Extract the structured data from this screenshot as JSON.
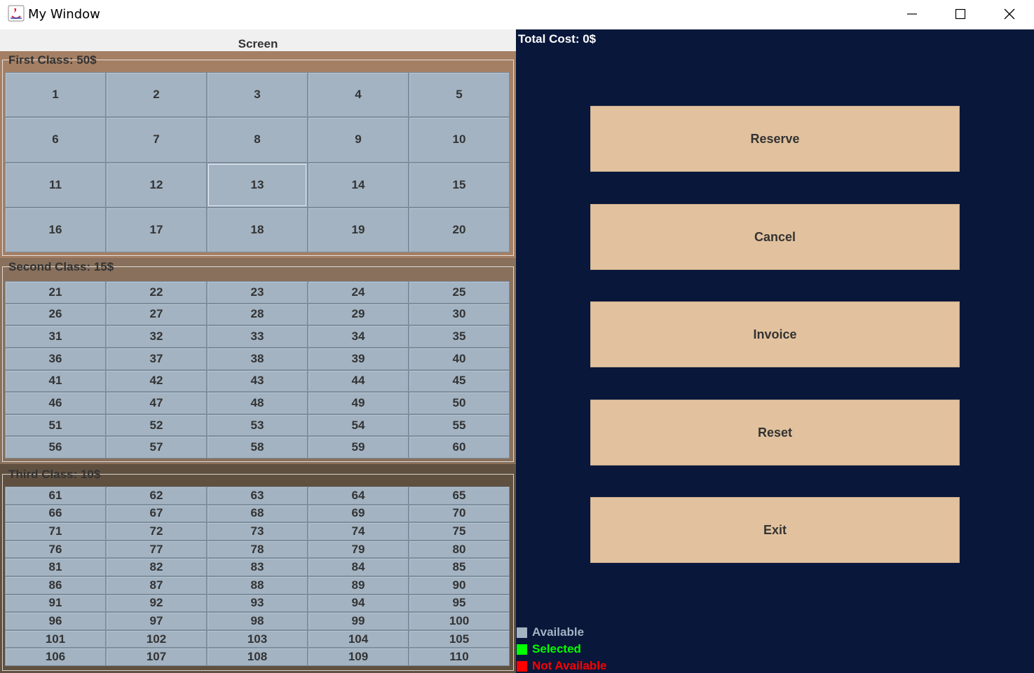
{
  "window": {
    "title": "My Window"
  },
  "seating": {
    "screen_label": "Screen",
    "sections": [
      {
        "title": "First Class: 50$",
        "seats": [
          "1",
          "2",
          "3",
          "4",
          "5",
          "6",
          "7",
          "8",
          "9",
          "10",
          "11",
          "12",
          "13",
          "14",
          "15",
          "16",
          "17",
          "18",
          "19",
          "20"
        ]
      },
      {
        "title": "Second Class: 15$",
        "seats": [
          "21",
          "22",
          "23",
          "24",
          "25",
          "26",
          "27",
          "28",
          "29",
          "30",
          "31",
          "32",
          "33",
          "34",
          "35",
          "36",
          "37",
          "38",
          "39",
          "40",
          "41",
          "42",
          "43",
          "44",
          "45",
          "46",
          "47",
          "48",
          "49",
          "50",
          "51",
          "52",
          "53",
          "54",
          "55",
          "56",
          "57",
          "58",
          "59",
          "60"
        ]
      },
      {
        "title": "Third Class: 10$",
        "seats": [
          "61",
          "62",
          "63",
          "64",
          "65",
          "66",
          "67",
          "68",
          "69",
          "70",
          "71",
          "72",
          "73",
          "74",
          "75",
          "76",
          "77",
          "78",
          "79",
          "80",
          "81",
          "82",
          "83",
          "84",
          "85",
          "86",
          "87",
          "88",
          "89",
          "90",
          "91",
          "92",
          "93",
          "94",
          "95",
          "96",
          "97",
          "98",
          "99",
          "100",
          "101",
          "102",
          "103",
          "104",
          "105",
          "106",
          "107",
          "108",
          "109",
          "110"
        ]
      }
    ],
    "focused_seat": "13"
  },
  "panel": {
    "total_cost": "Total Cost: 0$",
    "buttons": {
      "reserve": "Reserve",
      "cancel": "Cancel",
      "invoice": "Invoice",
      "reset": "Reset",
      "exit": "Exit"
    },
    "legend": [
      {
        "label": "Available",
        "color": "#a3b3c2"
      },
      {
        "label": "Selected",
        "color": "#00ff00"
      },
      {
        "label": "Not Available",
        "color": "#ff0000"
      }
    ]
  },
  "colors": {
    "seat_available": "#a3b3c2",
    "first_class_bg": "#a47f64",
    "second_class_bg": "#88705c",
    "third_class_bg": "#605040",
    "panel_bg": "#08173a",
    "button_bg": "#e2c29e"
  }
}
